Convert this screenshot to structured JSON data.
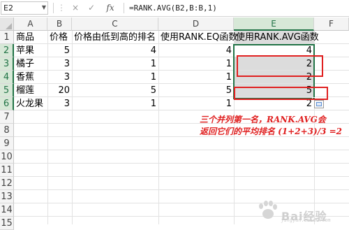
{
  "formula_bar": {
    "name_box": "E2",
    "cancel_symbol": "×",
    "enter_symbol": "✓",
    "fx_symbol": "fx",
    "formula": "=RANK.AVG(B2,B:B,1)"
  },
  "columns": [
    "A",
    "B",
    "C",
    "D",
    "E",
    "F"
  ],
  "rows": [
    "1",
    "2",
    "3",
    "4",
    "5",
    "6",
    "7",
    "8",
    "9",
    "10",
    "11",
    "12",
    "13",
    "14",
    "15"
  ],
  "table": {
    "headers": [
      "商品",
      "价格",
      "价格由低到高的排名",
      "使用RANK.EQ函数",
      "使用RANK.AVG函数"
    ],
    "rows": [
      [
        "苹果",
        "5",
        "4",
        "4",
        "4"
      ],
      [
        "橘子",
        "3",
        "1",
        "1",
        "2"
      ],
      [
        "香蕉",
        "3",
        "1",
        "1",
        "2"
      ],
      [
        "榴莲",
        "20",
        "5",
        "5",
        "5"
      ],
      [
        "火龙果",
        "3",
        "1",
        "1",
        "2"
      ]
    ]
  },
  "annotation": {
    "line1": "三个并列第一名，RANK.AVG会",
    "line2": "返回它们的平均排名 (1+2+3)/3 =2"
  },
  "watermark": {
    "text": "Bai经验",
    "sub": "jingyan.baidu.com"
  },
  "colors": {
    "excel_green": "#217346",
    "annotation_red": "#e02020",
    "selection_gray": "#dcdcdc"
  }
}
